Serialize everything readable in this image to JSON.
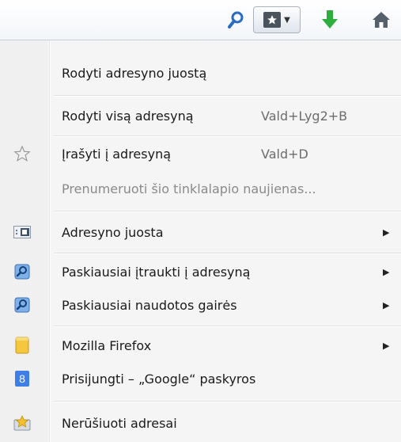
{
  "menu": {
    "items": [
      {
        "label": "Rodyti adresyno juostą"
      },
      {
        "label": "Rodyti visą adresyną",
        "shortcut": "Vald+Lyg2+B"
      },
      {
        "label": "Įrašyti į adresyną",
        "shortcut": "Vald+D",
        "icon": "star-outline-icon"
      },
      {
        "label": "Prenumeruoti šio tinklalapio naujienas...",
        "disabled": true
      },
      {
        "label": "Adresyno juosta",
        "icon": "bookmarks-toolbar-icon"
      },
      {
        "label": "Paskiausiai įtraukti į adresyną",
        "icon": "smart-folder-icon"
      },
      {
        "label": "Paskiausiai naudotos gairės",
        "icon": "smart-folder-icon"
      },
      {
        "label": "Mozilla Firefox",
        "icon": "folder-icon"
      },
      {
        "label": "Prisijungti – „Google“ paskyros",
        "icon": "google-icon",
        "icon_text": "8"
      },
      {
        "label": "Nerūšiuoti adresai",
        "icon": "unsorted-bookmarks-icon"
      }
    ]
  },
  "toolbar": {
    "icons": [
      "search-icon",
      "bookmarks-menu-icon",
      "download-icon",
      "home-icon"
    ]
  },
  "colors": {
    "download_green": "#2eae3f",
    "search_blue": "#2a6bc4",
    "google_blue": "#3d7ee8",
    "folder_yellow": "#f4c73f"
  }
}
